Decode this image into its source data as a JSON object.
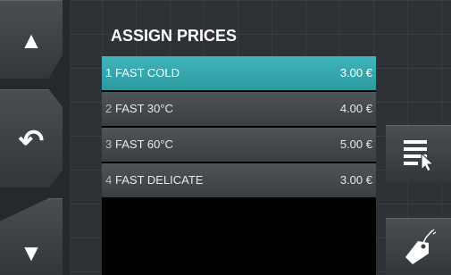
{
  "screen": {
    "title": "ASSIGN PRICES"
  },
  "nav": {
    "up_icon": "arrow-up-icon",
    "back_icon": "back-arrow-icon",
    "down_icon": "arrow-down-icon",
    "up_glyph": "▲",
    "back_glyph": "↶",
    "down_glyph": "▼"
  },
  "programs": [
    {
      "number": "1",
      "name": "FAST COLD",
      "price": "3.00 €",
      "selected": true
    },
    {
      "number": "2",
      "name": "FAST 30°C",
      "price": "4.00 €",
      "selected": false
    },
    {
      "number": "3",
      "name": "FAST 60°C",
      "price": "5.00 €",
      "selected": false
    },
    {
      "number": "4",
      "name": "FAST DELICATE",
      "price": "3.00 €",
      "selected": false
    }
  ],
  "actions": {
    "list_icon": "list-select-icon",
    "tag_icon": "price-tag-icon"
  },
  "colors": {
    "background": "#2e3135",
    "selected_row": "#3fb5bb",
    "row": "#4f5459",
    "list_background": "#000000"
  }
}
